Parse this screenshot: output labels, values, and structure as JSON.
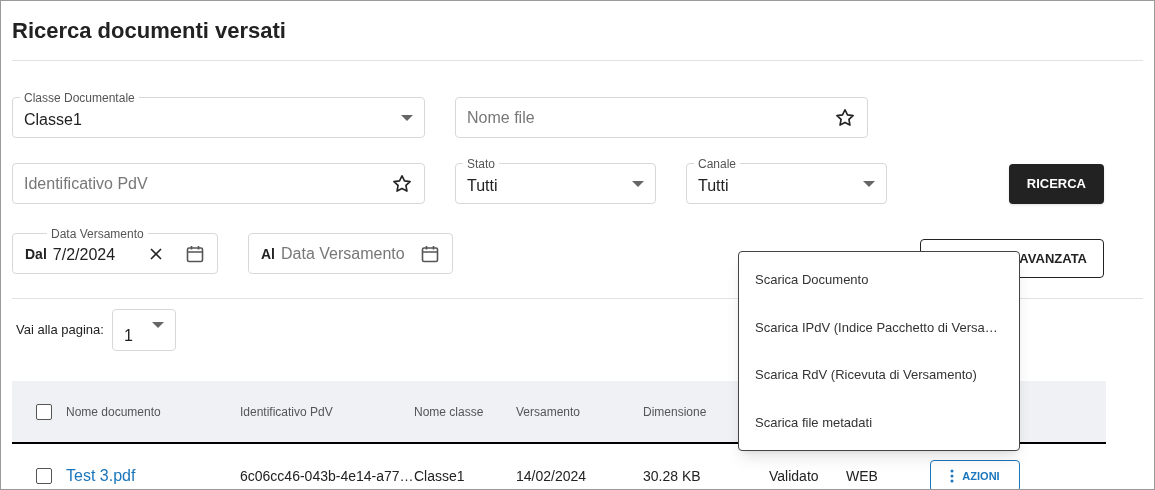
{
  "title": "Ricerca documenti versati",
  "filter_rows": [
    [
      {
        "kind": "select",
        "label": "Classe Documentale",
        "value": "Classe1"
      },
      {
        "kind": "text",
        "placeholder": "Nome file"
      }
    ],
    [
      {
        "kind": "text",
        "placeholder": "Identificativo PdV"
      },
      {
        "kind": "select",
        "label": "Stato",
        "value": "Tutti"
      },
      {
        "kind": "select",
        "label": "Canale",
        "value": "Tutti"
      }
    ],
    [
      {
        "kind": "date",
        "label": "Data Versamento",
        "prefix": "Dal",
        "value": "7/2/2024"
      },
      {
        "kind": "date",
        "prefix": "Al",
        "placeholder": "Data Versamento"
      }
    ]
  ],
  "search_button": "RICERCA",
  "advanced_button": "AVANZATA",
  "pager": {
    "label": "Vai alla pagina:",
    "value": "1"
  },
  "table": {
    "select_all": {
      "checked": false
    },
    "columns": [
      "Nome documento",
      "Identificativo PdV",
      "Nome classe",
      "Versamento",
      "Dimensione"
    ],
    "rows": [
      {
        "checked": false,
        "cells": [
          "Test 3.pdf",
          "6c06cc46-043b-4e14-a77…",
          "Classe1",
          "14/02/2024",
          "30.28 KB",
          "Validato",
          "WEB"
        ],
        "action": "AZIONI"
      }
    ]
  },
  "menu": [
    "Scarica Documento",
    "Scarica IPdV (Indice Pacchetto di Versa…",
    "Scarica RdV (Ricevuta di Versamento)",
    "Scarica file metadati"
  ]
}
